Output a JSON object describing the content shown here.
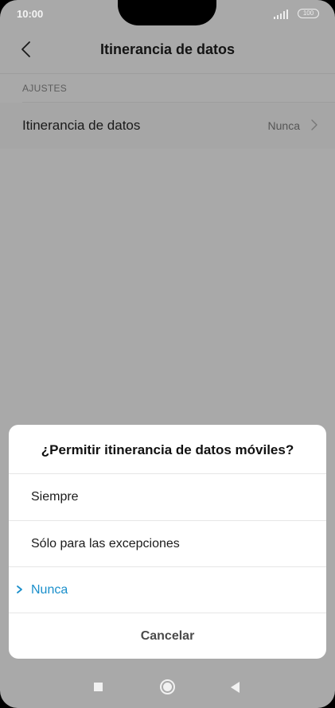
{
  "status_bar": {
    "time": "10:00",
    "battery": "100"
  },
  "app_bar": {
    "title": "Itinerancia de datos"
  },
  "settings": {
    "section_header": "AJUSTES",
    "row": {
      "label": "Itinerancia de datos",
      "value": "Nunca"
    }
  },
  "dialog": {
    "title": "¿Permitir itinerancia de datos móviles?",
    "options": [
      {
        "label": "Siempre",
        "selected": false
      },
      {
        "label": "Sólo para las excepciones",
        "selected": false
      },
      {
        "label": "Nunca",
        "selected": true
      }
    ],
    "cancel_label": "Cancelar"
  },
  "colors": {
    "accent": "#1a8fcb",
    "scrim_background": "#a9a9a9",
    "dialog_background": "#ffffff"
  },
  "icons": [
    "back-icon",
    "signal-icon",
    "battery-icon",
    "chevron-right-icon",
    "check-icon",
    "recents-icon",
    "home-icon",
    "back-nav-icon"
  ]
}
